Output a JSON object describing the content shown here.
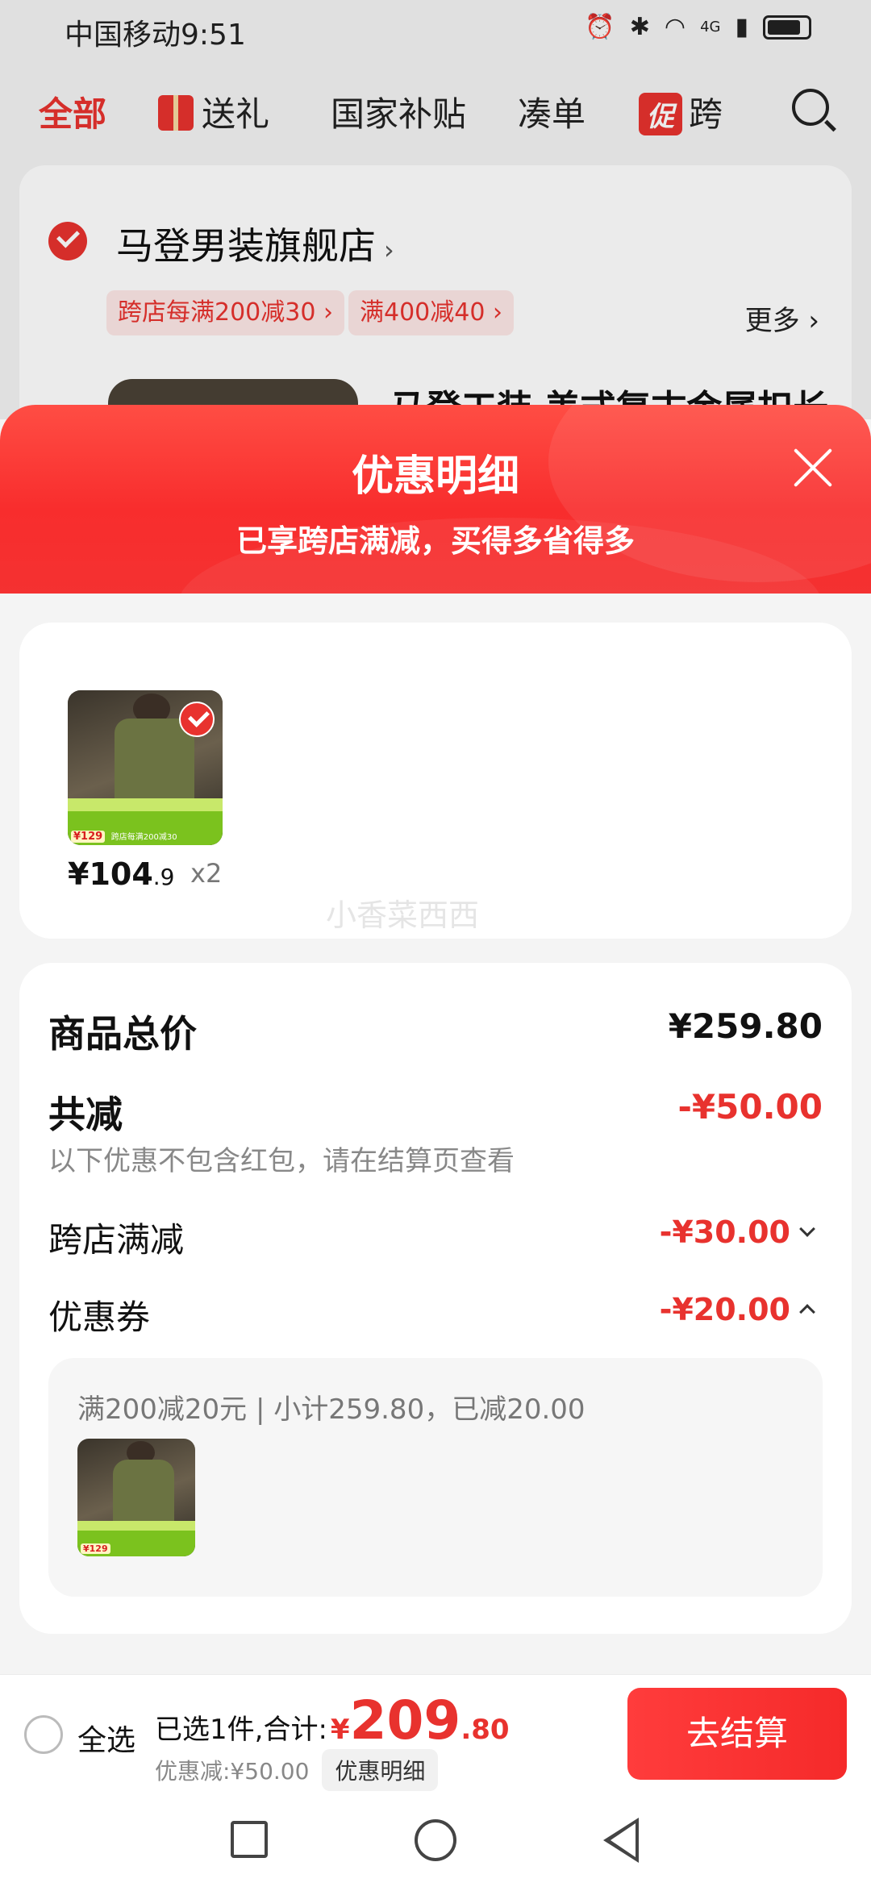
{
  "status_bar": {
    "carrier_time": "中国移动9:51",
    "icons": [
      "alarm-icon",
      "bluetooth-icon",
      "wifi-icon",
      "signal-icon",
      "battery-icon"
    ],
    "network": "4G"
  },
  "top_tabs": [
    {
      "label": "全部",
      "active": true
    },
    {
      "label": "送礼",
      "icon": "gift-icon"
    },
    {
      "label": "国家补贴"
    },
    {
      "label": "凑单"
    },
    {
      "label": "跨",
      "badge": "促"
    }
  ],
  "store": {
    "name": "马登男装旗舰店",
    "chevron": "›",
    "coupons": [
      "跨店每满200减30 ›",
      "满400减40 ›"
    ],
    "more": "更多 ›",
    "product_title": "马登工装 美式复古金属扣长"
  },
  "sheet": {
    "title": "优惠明细",
    "subtitle": "已享跨店满减，买得多省得多"
  },
  "goods": {
    "price_main": "¥104",
    "price_cents": ".9",
    "quantity": "x2",
    "thumb_price": "¥129",
    "thumb_strip_text": "跨店每满200减30",
    "watermark": "小香菜西西"
  },
  "details": {
    "total_label": "商品总价",
    "total_value": "¥259.80",
    "reduce_label": "共减",
    "reduce_value": "-¥50.00",
    "note": "以下优惠不包含红包，请在结算页查看",
    "cross_store_label": "跨店满减",
    "cross_store_value": "-¥30.00",
    "coupon_label": "优惠券",
    "coupon_value": "-¥20.00",
    "coupon_detail": "满200减20元 | 小计259.80，已减20.00"
  },
  "checkout": {
    "select_all": "全选",
    "prefix": "已选1件,合计:",
    "yen": "¥",
    "total_int": "209",
    "total_dec": ".80",
    "discount": "优惠减:¥50.00",
    "detail_chip": "优惠明细",
    "button": "去结算"
  },
  "colors": {
    "accent_red": "#e8322e",
    "header_gradient_top": "#ff4d44",
    "header_gradient_bottom": "#f43131"
  }
}
